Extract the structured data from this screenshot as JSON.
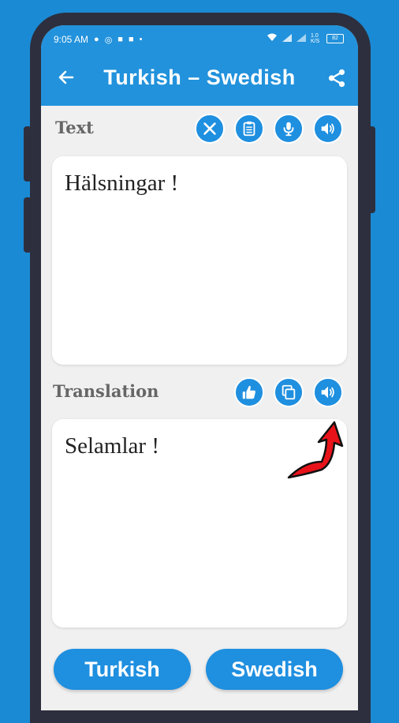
{
  "status": {
    "time": "9:05 AM",
    "network_speed": "1.0 K/S",
    "battery": "82"
  },
  "appbar": {
    "title": "Turkish – Swedish"
  },
  "source": {
    "label": "Text",
    "text": "Hälsningar !"
  },
  "translation": {
    "label": "Translation",
    "text": "Selamlar !"
  },
  "buttons": {
    "left_language": "Turkish",
    "right_language": "Swedish"
  },
  "colors": {
    "background": "#1a8ad4",
    "accent": "#1f8fe0",
    "annotation_arrow": "#e8131a"
  }
}
